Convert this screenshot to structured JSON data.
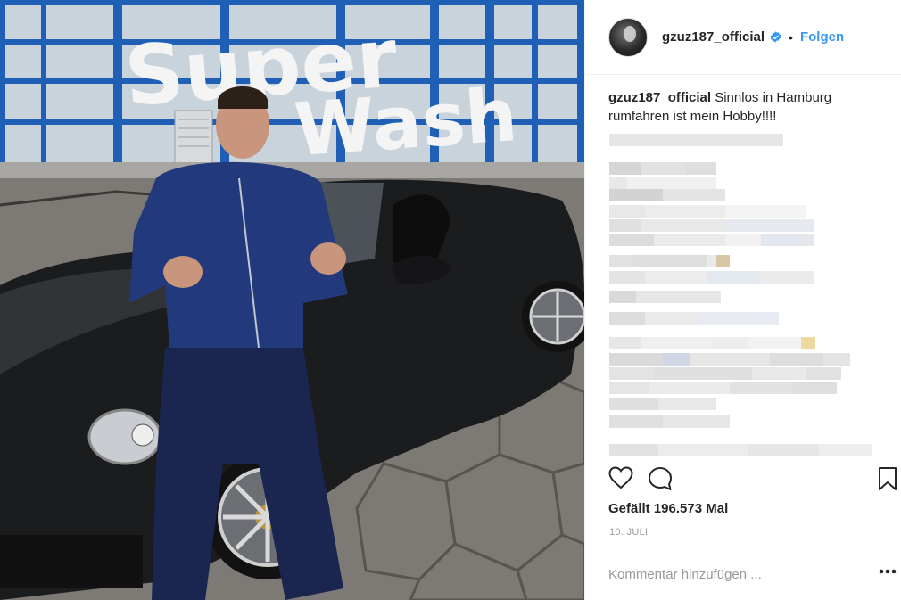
{
  "post": {
    "username": "gzuz187_official",
    "follow_label": "Folgen",
    "separator": "•",
    "caption_text": "Sinnlos in Hamburg rumfahren ist mein Hobby!!!!",
    "likes_text": "Gefällt 196.573 Mal",
    "date_text": "10. JULI",
    "comment_placeholder": "Kommentar hinzufügen ..."
  },
  "photo": {
    "sign_line1": "Super",
    "sign_line2": "Wash"
  },
  "icons": {
    "avatar": "profile-picture",
    "verified": "verified-badge-icon",
    "like": "heart-outline-icon",
    "comment": "speech-bubble-icon",
    "save": "bookmark-outline-icon",
    "more": "ellipsis-icon"
  },
  "colors": {
    "link_blue": "#3897f0",
    "text": "#262626",
    "muted": "#999999",
    "divider": "#efefef"
  }
}
